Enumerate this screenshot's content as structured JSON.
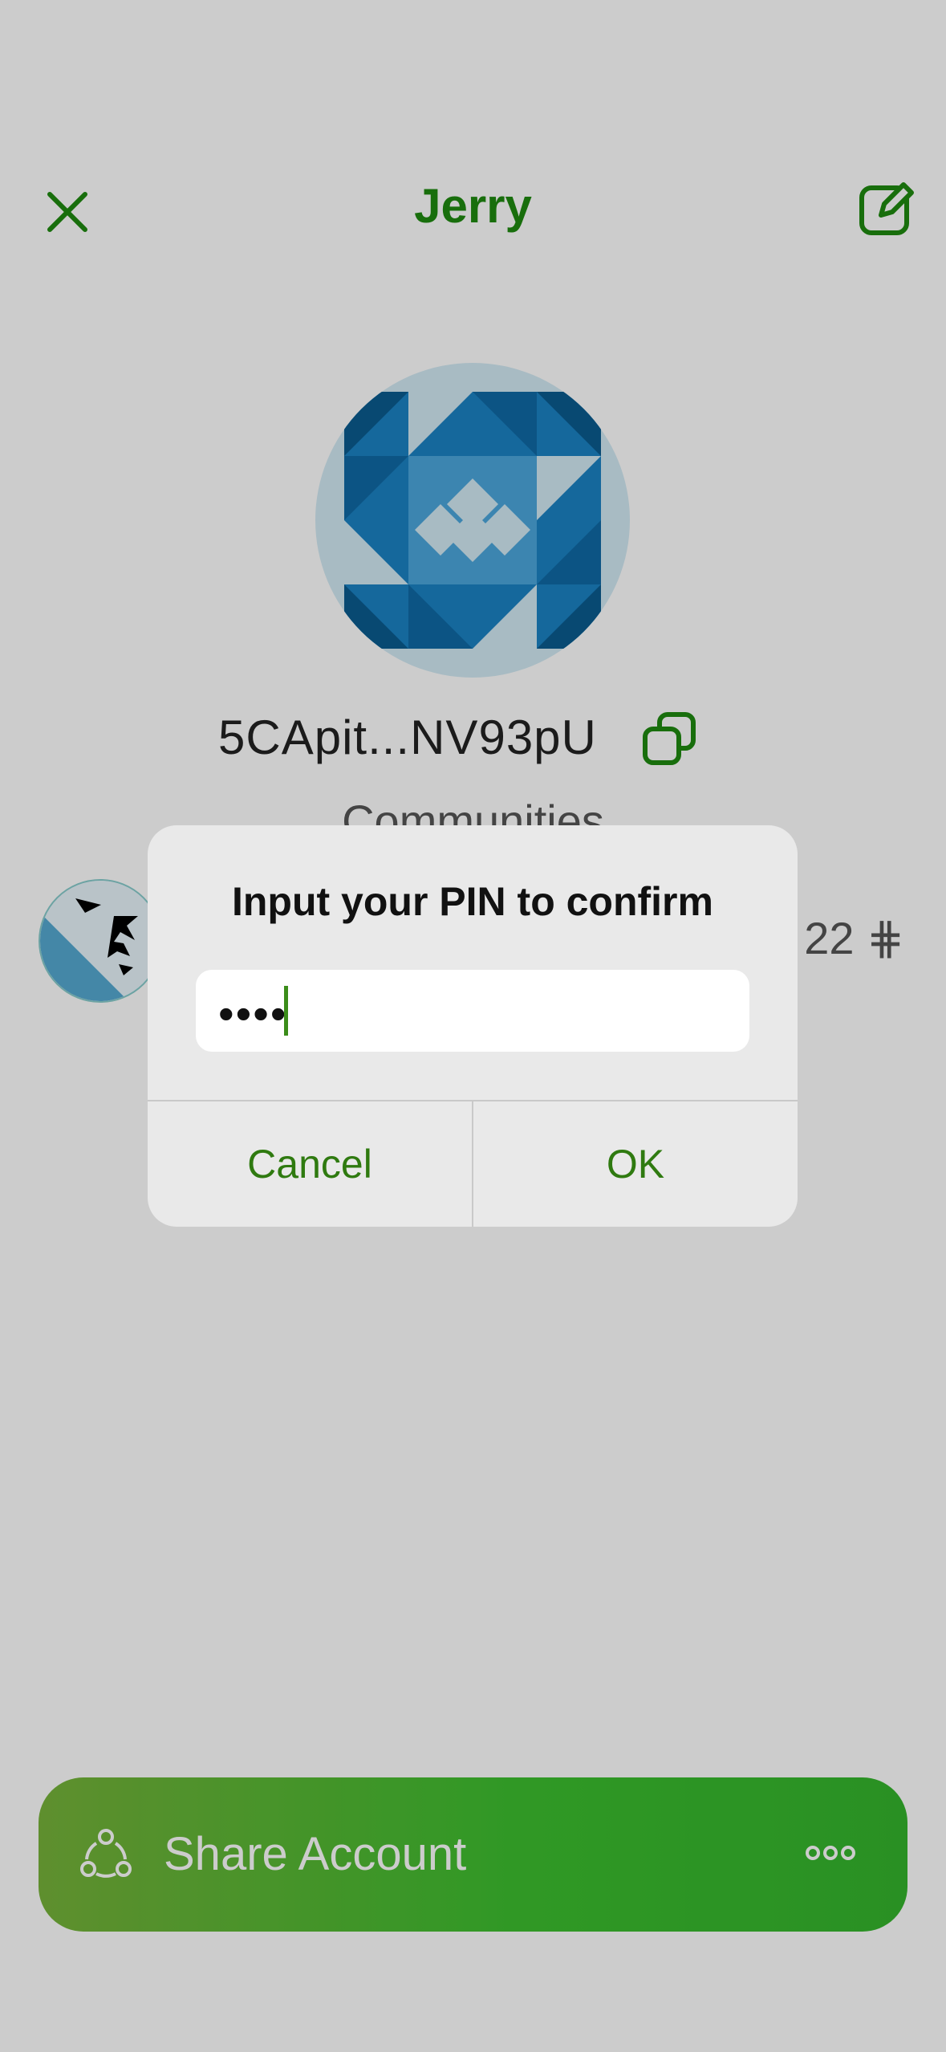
{
  "header": {
    "title": "Jerry",
    "close_icon": "close-icon",
    "edit_icon": "edit-icon"
  },
  "account": {
    "address": "5CApit...NV93pU",
    "copy_icon": "copy-icon"
  },
  "communities": {
    "section_title": "Communities",
    "items": [
      {
        "balance": "22 ⋕"
      }
    ]
  },
  "dialog": {
    "title": "Input your PIN to confirm",
    "pin_value": "••••",
    "cancel_label": "Cancel",
    "ok_label": "OK"
  },
  "share": {
    "label": "Share Account",
    "share_icon": "share-icon",
    "more_icon": "more-icon"
  },
  "colors": {
    "accent": "#1f8a10",
    "share_start": "#77b33a",
    "share_end": "#34b52c"
  }
}
